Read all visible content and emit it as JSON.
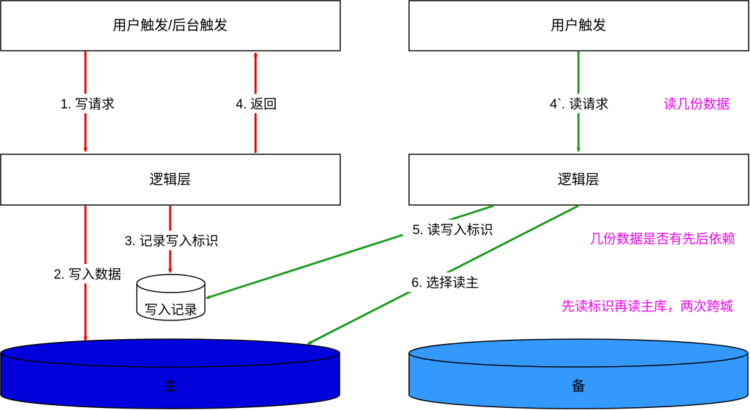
{
  "boxes": {
    "left_trigger": "用户触发/后台触发",
    "right_trigger": "用户触发",
    "left_logic": "逻辑层",
    "right_logic": "逻辑层"
  },
  "arrows": {
    "write_request": "1. 写请求",
    "return": "4. 返回",
    "record_write_flag": "3. 记录写入标识",
    "write_data": "2. 写入数据",
    "read_request": "4`. 读请求",
    "read_write_flag": "5. 读写入标识",
    "choose_read_master": "6. 选择读主"
  },
  "small_store": {
    "label": "写入记录"
  },
  "databases": {
    "master": "主",
    "standby": "备"
  },
  "notes": {
    "note1": "读几份数据",
    "note2": "几份数据是否有先后依赖",
    "note3": "先读标识再读主库，两次跨城"
  },
  "colors": {
    "red_arrow": "#ee0000",
    "green_arrow": "#1a9c1a",
    "master_db": "#0000dd",
    "standby_db": "#3399ff",
    "note_text": "#ee00ee"
  }
}
